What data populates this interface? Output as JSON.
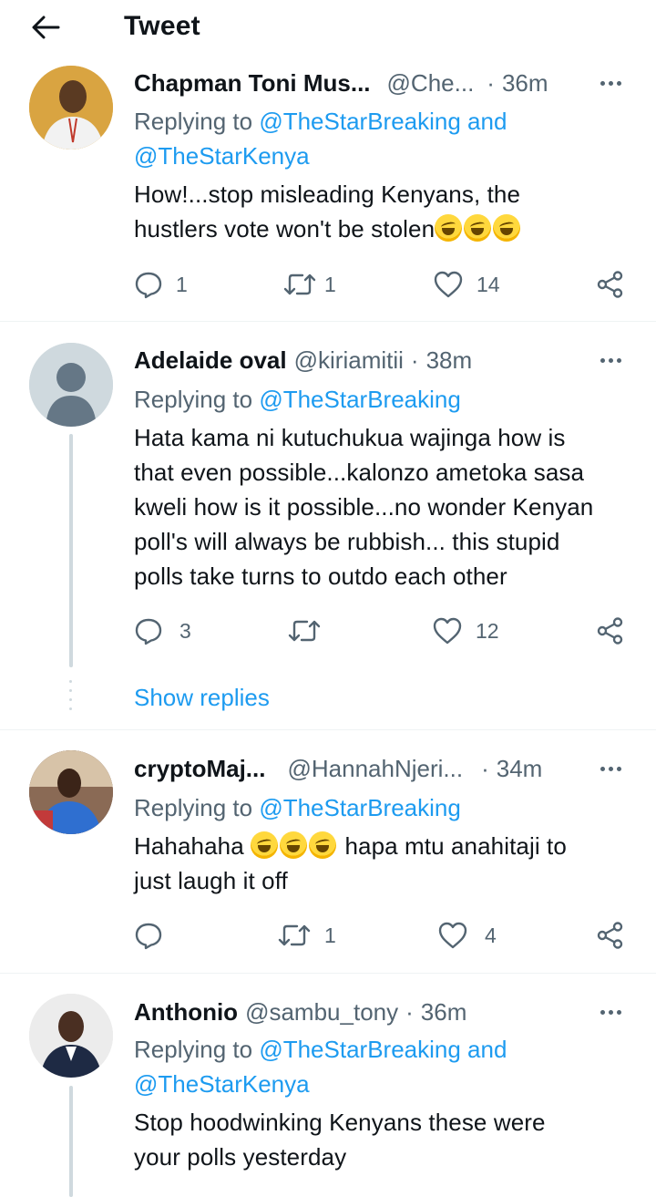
{
  "header": {
    "title": "Tweet"
  },
  "replies": [
    {
      "name": "Chapman Toni Mus...",
      "handle": "@Che...",
      "separator": "·",
      "time": "36m",
      "replying_prefix": "Replying to",
      "replying_line1": "@TheStarBreaking and",
      "replying_line2": "@TheStarKenya",
      "text_line1": "How!...stop misleading Kenyans, the",
      "text_line2": "hustlers vote won't be stolen",
      "emoji": "rolling-on-floor-laughing-emoji",
      "replies_count": "1",
      "retweets_count": "1",
      "likes_count": "14"
    },
    {
      "name": "Adelaide oval",
      "handle": "@kiriamitii",
      "separator": "·",
      "time": "38m",
      "replying_prefix": "Replying to",
      "replying_line1": "@TheStarBreaking",
      "text_lines": [
        "Hata kama ni kutuchukua wajinga how is",
        "that even possible...kalonzo ametoka sasa",
        "kweli how is it possible...no wonder Kenyan",
        "poll's will always be rubbish... this stupid",
        "polls take turns to outdo each other"
      ],
      "replies_count": "3",
      "retweets_count": "",
      "likes_count": "12",
      "show_replies": "Show replies"
    },
    {
      "name": "cryptoMaj...",
      "handle": "@HannahNjeri...",
      "separator": "·",
      "time": "34m",
      "replying_prefix": "Replying to",
      "replying_line1": "@TheStarBreaking",
      "text_line1_a": "Hahahaha",
      "text_line1_b": "hapa mtu anahitaji to",
      "text_line2": "just laugh it off",
      "replies_count": "",
      "retweets_count": "1",
      "likes_count": "4"
    },
    {
      "name": "Anthonio",
      "handle": "@sambu_tony",
      "separator": "·",
      "time": "36m",
      "replying_prefix": "Replying to",
      "replying_line1": "@TheStarBreaking and",
      "replying_line2": "@TheStarKenya",
      "text_line1": "Stop hoodwinking Kenyans these were",
      "text_line2": "your polls yesterday"
    }
  ],
  "icons": {
    "back": "arrow-left-icon",
    "more": "more-horizontal-icon",
    "reply": "reply-bubble-icon",
    "retweet": "retweet-icon",
    "like": "heart-icon",
    "share": "share-icon"
  },
  "colors": {
    "link": "#1d9bf0",
    "secondary": "#536471",
    "text": "#0f1419",
    "divider": "#eff3f4"
  }
}
